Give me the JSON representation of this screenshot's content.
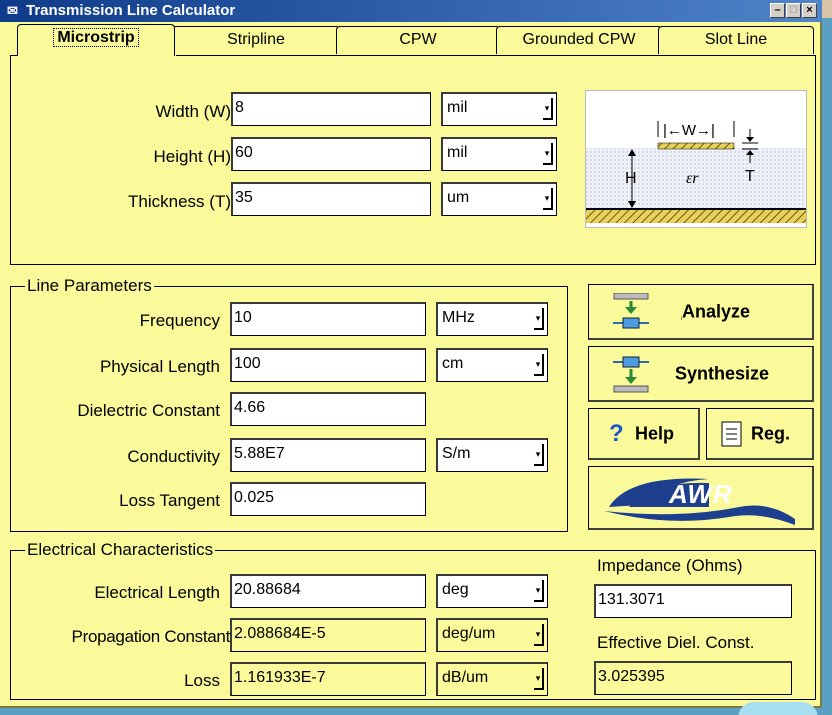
{
  "window": {
    "title": "Transmission Line Calculator"
  },
  "tabs": [
    {
      "label": "Microstrip",
      "active": true
    },
    {
      "label": "Stripline"
    },
    {
      "label": "CPW"
    },
    {
      "label": "Grounded CPW"
    },
    {
      "label": "Slot Line"
    }
  ],
  "dims": {
    "width": {
      "label": "Width (W)",
      "value": "8",
      "unit": "mil"
    },
    "height": {
      "label": "Height (H)",
      "value": "60",
      "unit": "mil"
    },
    "thickness": {
      "label": "Thickness (T)",
      "value": "35",
      "unit": "um"
    }
  },
  "diagram": {
    "w": "|←W→|",
    "h": "H",
    "t": "T",
    "er": "εr"
  },
  "line_params": {
    "title": "Line Parameters",
    "frequency": {
      "label": "Frequency",
      "value": "10",
      "unit": "MHz"
    },
    "length": {
      "label": "Physical Length",
      "value": "100",
      "unit": "cm"
    },
    "dielectric": {
      "label": "Dielectric Constant",
      "value": "4.66"
    },
    "conductivity": {
      "label": "Conductivity",
      "value": "5.88E7",
      "unit": "S/m"
    },
    "loss_tangent": {
      "label": "Loss Tangent",
      "value": "0.025"
    }
  },
  "buttons": {
    "analyze": "Analyze",
    "synthesize": "Synthesize",
    "help": "Help",
    "reg": "Reg.",
    "logo": "AWR"
  },
  "electrical": {
    "title": "Electrical Characteristics",
    "elec_length": {
      "label": "Electrical Length",
      "value": "20.88684",
      "unit": "deg"
    },
    "prop_const": {
      "label": "Propagation Constant",
      "value": "2.088684E-5",
      "unit": "deg/um"
    },
    "loss": {
      "label": "Loss",
      "value": "1.161933E-7",
      "unit": "dB/um"
    }
  },
  "results": {
    "impedance_label": "Impedance (Ohms)",
    "impedance_value": "131.3071",
    "eff_label": "Effective Diel. Const.",
    "eff_value": "3.025395"
  },
  "colors": {
    "panel": "#fbfa9a",
    "title_from": "#0f3b8a",
    "title_to": "#4f84c8",
    "logo": "#1d3f8e"
  }
}
